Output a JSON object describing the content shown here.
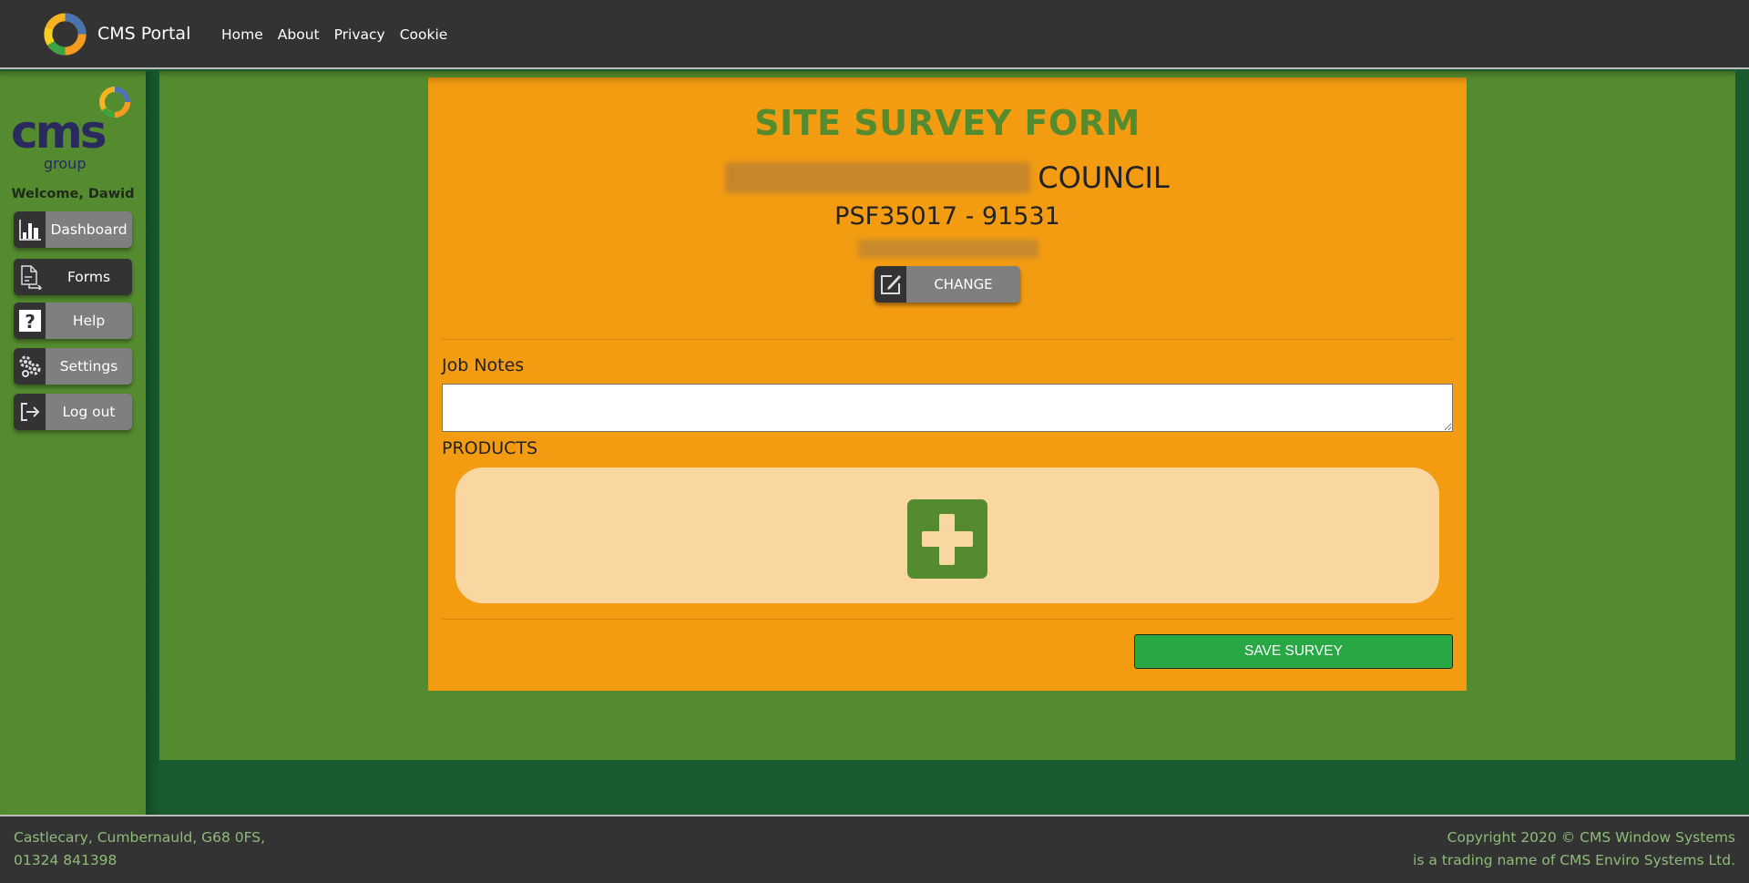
{
  "header": {
    "brand_name": "CMS Portal",
    "nav": [
      {
        "label": "Home"
      },
      {
        "label": "About"
      },
      {
        "label": "Privacy"
      },
      {
        "label": "Cookie"
      }
    ]
  },
  "sidebar": {
    "logo_text": "cms",
    "logo_subtext": "group",
    "welcome": "Welcome, Dawid",
    "items": [
      {
        "label": "Dashboard",
        "icon": "bar-chart-icon",
        "active": false
      },
      {
        "label": "Forms",
        "icon": "document-icon",
        "active": true
      },
      {
        "label": "Help",
        "icon": "help-icon",
        "active": false
      },
      {
        "label": "Settings",
        "icon": "gears-icon",
        "active": false
      },
      {
        "label": "Log out",
        "icon": "logout-icon",
        "active": false
      }
    ]
  },
  "form": {
    "title": "SITE SURVEY FORM",
    "council_suffix": "COUNCIL",
    "reference": "PSF35017 - 91531",
    "change_label": "CHANGE",
    "job_notes_label": "Job Notes",
    "job_notes_value": "",
    "products_label": "PRODUCTS",
    "save_label": "SAVE SURVEY"
  },
  "footer": {
    "address_line1": "Castlecary, Cumbernauld, G68 0FS,",
    "address_line2": "01324 841398",
    "copyright_line1": "Copyright 2020 © CMS Window Systems",
    "copyright_line2": "is a trading name of CMS Enviro Systems Ltd."
  },
  "colors": {
    "header_bg": "#333333",
    "sidebar_green": "#548b2f",
    "dark_green": "#1a5a30",
    "panel_orange": "#f39c12",
    "products_bg": "#fad7a0",
    "save_green": "#28a745",
    "footer_text": "#8fbb7a"
  }
}
